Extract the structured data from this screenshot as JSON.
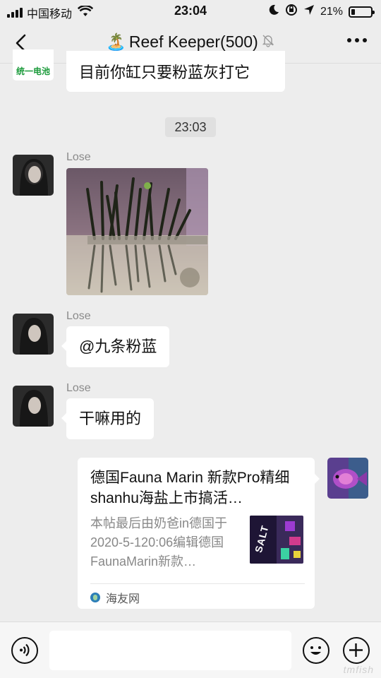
{
  "status_bar": {
    "carrier": "中国移动",
    "time": "23:04",
    "battery": "21%",
    "battery_level": 0.21
  },
  "nav": {
    "title": "Reef Keeper(500)",
    "title_emoji": "🏝️"
  },
  "messages": {
    "previous": {
      "avatar_text": "统一电池",
      "text": "目前你缸只要粉蓝灰打它"
    },
    "timestamp": "23:03",
    "image_msg": {
      "sender": "Lose"
    },
    "mention_msg": {
      "sender": "Lose",
      "text": "@九条粉蓝"
    },
    "question_msg": {
      "sender": "Lose",
      "text": "干嘛用的"
    },
    "link_card": {
      "title": "德国Fauna Marin 新款Pro精细shanhu海盐上市搞活…",
      "description": "本帖最后由奶爸in德国于2020-5-120:06编辑德国FaunaMarin新款…",
      "thumb_text": "SALT",
      "source": "海友网"
    }
  },
  "input": {
    "placeholder": ""
  },
  "watermark": "tmfish"
}
